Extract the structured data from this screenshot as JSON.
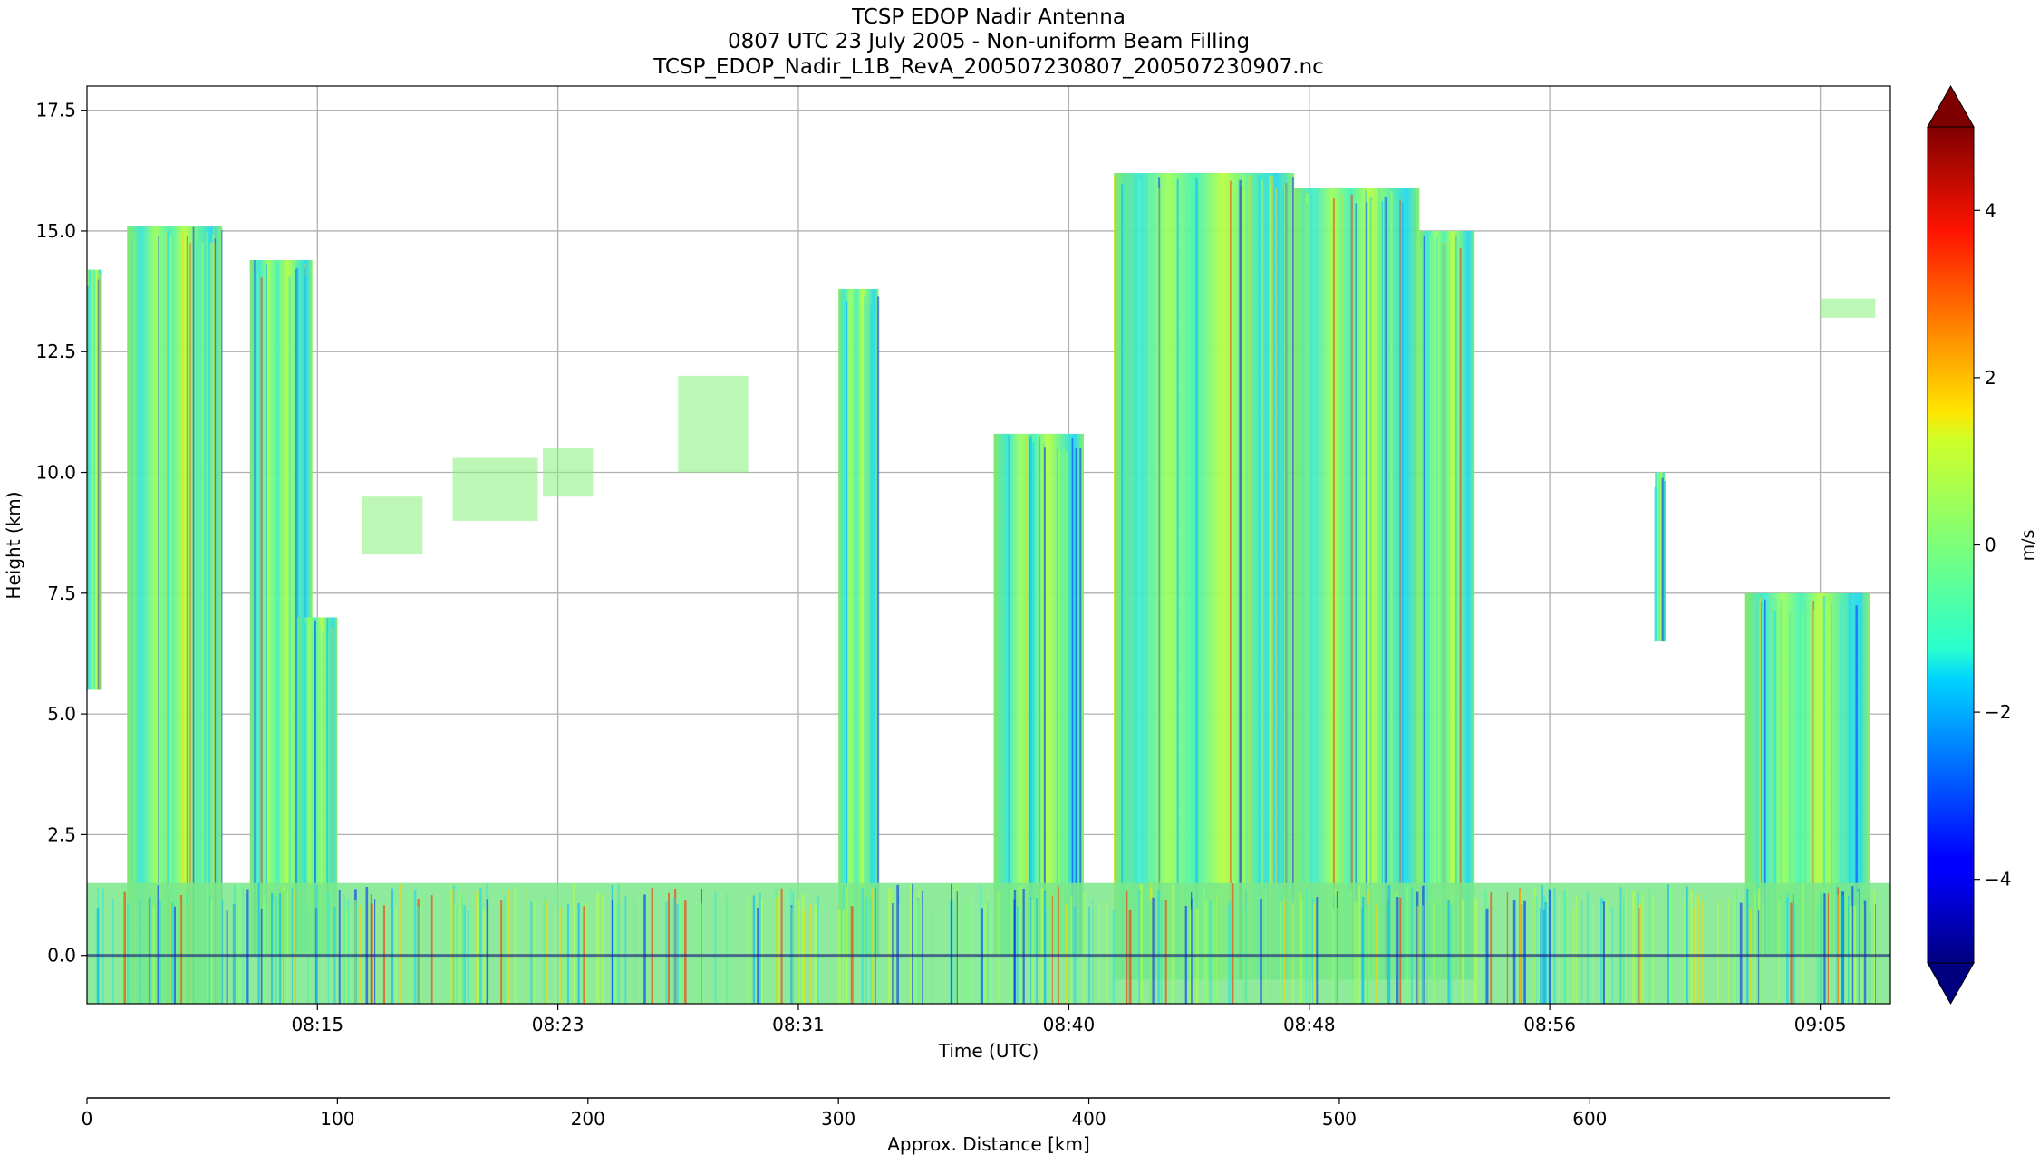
{
  "chart_data": {
    "type": "heatmap",
    "title_lines": [
      "TCSP EDOP Nadir Antenna",
      "0807 UTC 23 July 2005 - Non-uniform Beam Filling",
      "TCSP_EDOP_Nadir_L1B_RevA_200507230807_200507230907.nc"
    ],
    "xlabel": "Time (UTC)",
    "ylabel": "Height (km)",
    "x_axis": {
      "range": [
        "08:07:20",
        "09:07:20"
      ],
      "ticks": [
        {
          "label": "08:15",
          "value": "08:15"
        },
        {
          "label": "08:23",
          "value": "08:23"
        },
        {
          "label": "08:31",
          "value": "08:31"
        },
        {
          "label": "08:40",
          "value": "08:40"
        },
        {
          "label": "08:48",
          "value": "08:48"
        },
        {
          "label": "08:56",
          "value": "08:56"
        },
        {
          "label": "09:05",
          "value": "09:05"
        }
      ]
    },
    "y_axis": {
      "range": [
        -1.0,
        18.0
      ],
      "ticks": [
        {
          "label": "0.0",
          "value": 0.0
        },
        {
          "label": "2.5",
          "value": 2.5
        },
        {
          "label": "5.0",
          "value": 5.0
        },
        {
          "label": "7.5",
          "value": 7.5
        },
        {
          "label": "10.0",
          "value": 10.0
        },
        {
          "label": "12.5",
          "value": 12.5
        },
        {
          "label": "15.0",
          "value": 15.0
        },
        {
          "label": "17.5",
          "value": 17.5
        }
      ]
    },
    "distance_axis": {
      "xlabel": "Approx. Distance [km]",
      "range": [
        0,
        720
      ],
      "ticks": [
        {
          "label": "0",
          "value": 0
        },
        {
          "label": "100",
          "value": 100
        },
        {
          "label": "200",
          "value": 200
        },
        {
          "label": "300",
          "value": 300
        },
        {
          "label": "400",
          "value": 400
        },
        {
          "label": "500",
          "value": 500
        },
        {
          "label": "600",
          "value": 600
        }
      ]
    },
    "colorbar": {
      "label": "m/s",
      "range": [
        -5,
        5
      ],
      "extend": "both",
      "colormap": "jet",
      "ticks": [
        {
          "label": "−4",
          "value": -4
        },
        {
          "label": "−2",
          "value": -2
        },
        {
          "label": "0",
          "value": 0
        },
        {
          "label": "2",
          "value": 2
        },
        {
          "label": "4",
          "value": 4
        }
      ]
    },
    "grid": true,
    "cloud_columns": [
      {
        "start": "08:07:22",
        "end": "08:07:50",
        "top": 14.2,
        "bottom": 5.5
      },
      {
        "start": "08:08:40",
        "end": "08:11:50",
        "top": 15.1,
        "bottom": -1.0
      },
      {
        "start": "08:12:45",
        "end": "08:14:50",
        "top": 14.4,
        "bottom": 0.0
      },
      {
        "start": "08:14:20",
        "end": "08:15:40",
        "top": 7.0,
        "bottom": 0.0
      },
      {
        "start": "08:32:20",
        "end": "08:33:40",
        "top": 13.8,
        "bottom": 0.0
      },
      {
        "start": "08:37:30",
        "end": "08:40:30",
        "top": 10.8,
        "bottom": 0.0
      },
      {
        "start": "08:41:30",
        "end": "08:47:30",
        "top": 16.2,
        "bottom": -0.5
      },
      {
        "start": "08:47:30",
        "end": "08:51:40",
        "top": 15.9,
        "bottom": -0.5
      },
      {
        "start": "08:51:40",
        "end": "08:53:30",
        "top": 15.0,
        "bottom": -0.5
      },
      {
        "start": "08:59:30",
        "end": "08:59:50",
        "top": 10.0,
        "bottom": 6.5
      },
      {
        "start": "09:02:30",
        "end": "09:06:40",
        "top": 7.5,
        "bottom": 0.0
      }
    ],
    "scattered_echoes": [
      {
        "start": "08:16:30",
        "end": "08:18:30",
        "top": 9.5,
        "bottom": 8.3
      },
      {
        "start": "08:19:30",
        "end": "08:22:20",
        "top": 10.3,
        "bottom": 9.0
      },
      {
        "start": "08:22:30",
        "end": "08:24:10",
        "top": 10.5,
        "bottom": 9.5
      },
      {
        "start": "08:27:00",
        "end": "08:29:20",
        "top": 12.0,
        "bottom": 10.0
      },
      {
        "start": "09:05:00",
        "end": "09:06:50",
        "top": 13.6,
        "bottom": 13.2
      }
    ],
    "surface_band": {
      "top": 1.5,
      "bottom": -1.0
    }
  }
}
